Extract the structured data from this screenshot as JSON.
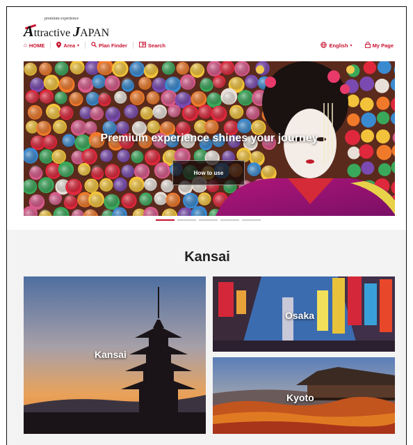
{
  "brand": {
    "tagline": "premium experience",
    "name_prefix": "A",
    "name_mid": "ttractive ",
    "name_j": "J",
    "name_suffix": "APAN"
  },
  "nav": {
    "home": "HOME",
    "area": "Area",
    "plan_finder": "Plan Finder",
    "search": "Search",
    "language": "English",
    "my_page": "My Page"
  },
  "hero": {
    "title": "Premium experience shines your journey",
    "button": "How to use",
    "slides": 5,
    "active_slide": 1
  },
  "region": {
    "title": "Kansai",
    "tiles": [
      {
        "label": "Kansai"
      },
      {
        "label": "Osaka"
      },
      {
        "label": "Kyoto"
      }
    ]
  },
  "colors": {
    "accent": "#c8102e",
    "section_bg": "#f3f3f3"
  }
}
